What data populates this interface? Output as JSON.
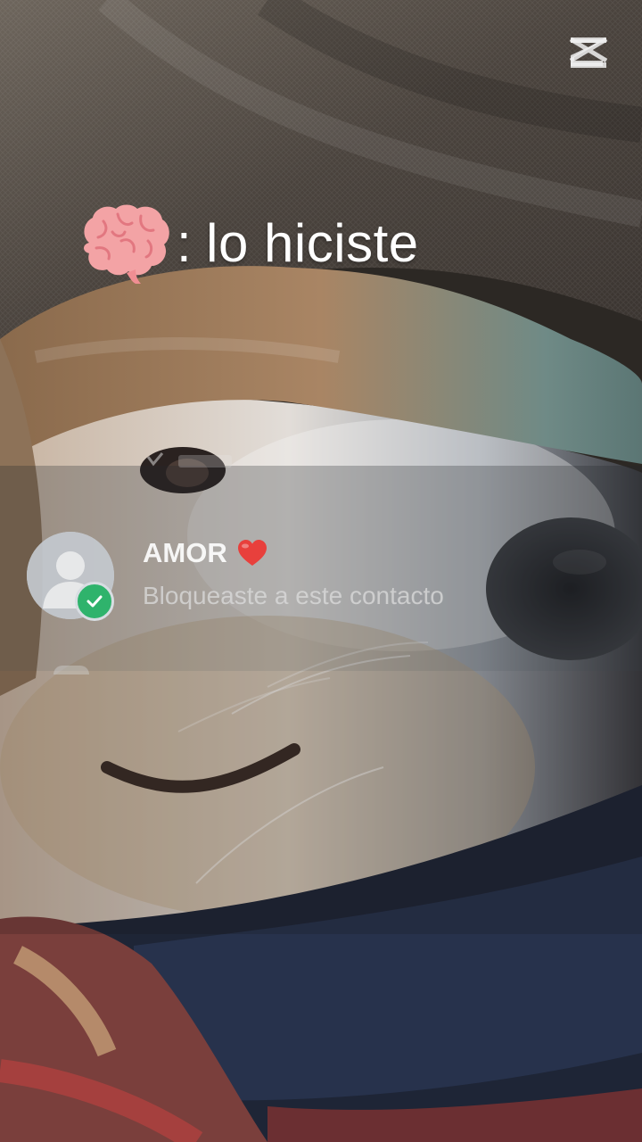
{
  "caption": {
    "emoji": "brain-icon",
    "separator": ":",
    "text": "lo hiciste"
  },
  "watermark": {
    "icon": "capcut-logo-icon"
  },
  "chat_row": {
    "contact_name": "AMOR",
    "name_emoji": "red-heart-icon",
    "last_message": "Bloqueaste a este contacto",
    "status_icon": "checkmark-icon",
    "avatar_icon": "default-user-icon"
  },
  "colors": {
    "check_badge": "#2fb36c",
    "heart": "#e8403c",
    "brain": "#f4a9aa"
  }
}
